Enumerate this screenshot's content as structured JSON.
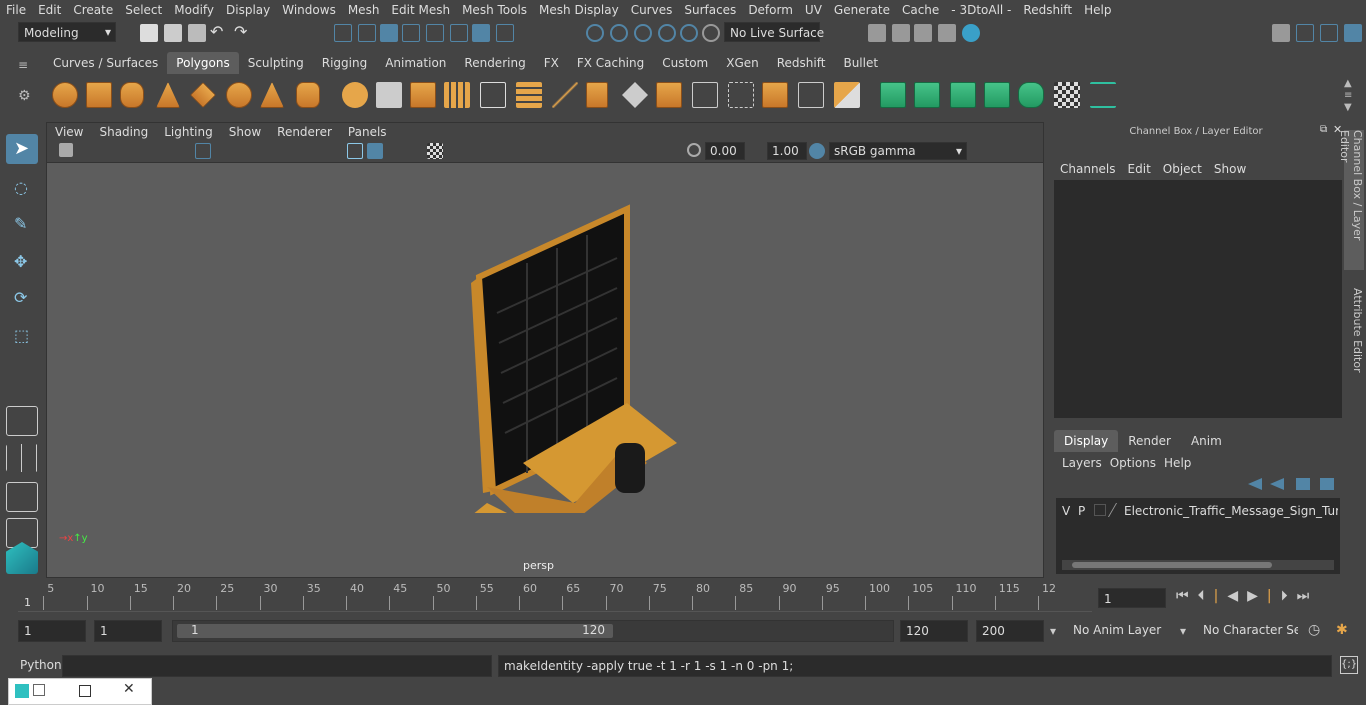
{
  "menubar": [
    "File",
    "Edit",
    "Create",
    "Select",
    "Modify",
    "Display",
    "Windows",
    "Mesh",
    "Edit Mesh",
    "Mesh Tools",
    "Mesh Display",
    "Curves",
    "Surfaces",
    "Deform",
    "UV",
    "Generate",
    "Cache",
    "- 3DtoAll -",
    "Redshift",
    "Help"
  ],
  "status": {
    "mode": "Modeling",
    "live_surface": "No Live Surface"
  },
  "shelf_tabs": [
    "Curves / Surfaces",
    "Polygons",
    "Sculpting",
    "Rigging",
    "Animation",
    "Rendering",
    "FX",
    "FX Caching",
    "Custom",
    "XGen",
    "Redshift",
    "Bullet"
  ],
  "shelf_active": "Polygons",
  "viewport": {
    "menu": [
      "View",
      "Shading",
      "Lighting",
      "Show",
      "Renderer",
      "Panels"
    ],
    "exposure": "0.00",
    "gamma": "1.00",
    "colorspace": "sRGB gamma",
    "camera": "persp"
  },
  "channel_box": {
    "title": "Channel Box / Layer Editor",
    "menu": [
      "Channels",
      "Edit",
      "Object",
      "Show"
    ],
    "layer_tabs": [
      "Display",
      "Render",
      "Anim"
    ],
    "layer_tab_active": "Display",
    "layer_menu": [
      "Layers",
      "Options",
      "Help"
    ],
    "layer": {
      "v": "V",
      "p": "P",
      "name": "Electronic_Traffic_Message_Sign_Turned_("
    }
  },
  "side_tabs": [
    "Channel Box / Layer Editor",
    "Attribute Editor"
  ],
  "timeline": {
    "ticks": [
      "5",
      "10",
      "15",
      "20",
      "25",
      "30",
      "35",
      "40",
      "45",
      "50",
      "55",
      "60",
      "65",
      "70",
      "75",
      "80",
      "85",
      "90",
      "95",
      "100",
      "105",
      "110",
      "115",
      "12"
    ],
    "start_marker": "1",
    "current_frame": "1"
  },
  "range": {
    "start": "1",
    "start2": "1",
    "slider_start": "1",
    "slider_end": "120",
    "end": "120",
    "end2": "200",
    "anim_layer": "No Anim Layer",
    "char_set": "No Character Set"
  },
  "command": {
    "lang": "Python",
    "output": "makeIdentity -apply true -t 1 -r 1 -s 1 -n 0 -pn 1;"
  },
  "colors": {
    "accent": "#5285a6",
    "orange": "#e6a64a",
    "panel": "#444444",
    "field": "#2b2b2b",
    "viewport": "#5d5d5d"
  }
}
